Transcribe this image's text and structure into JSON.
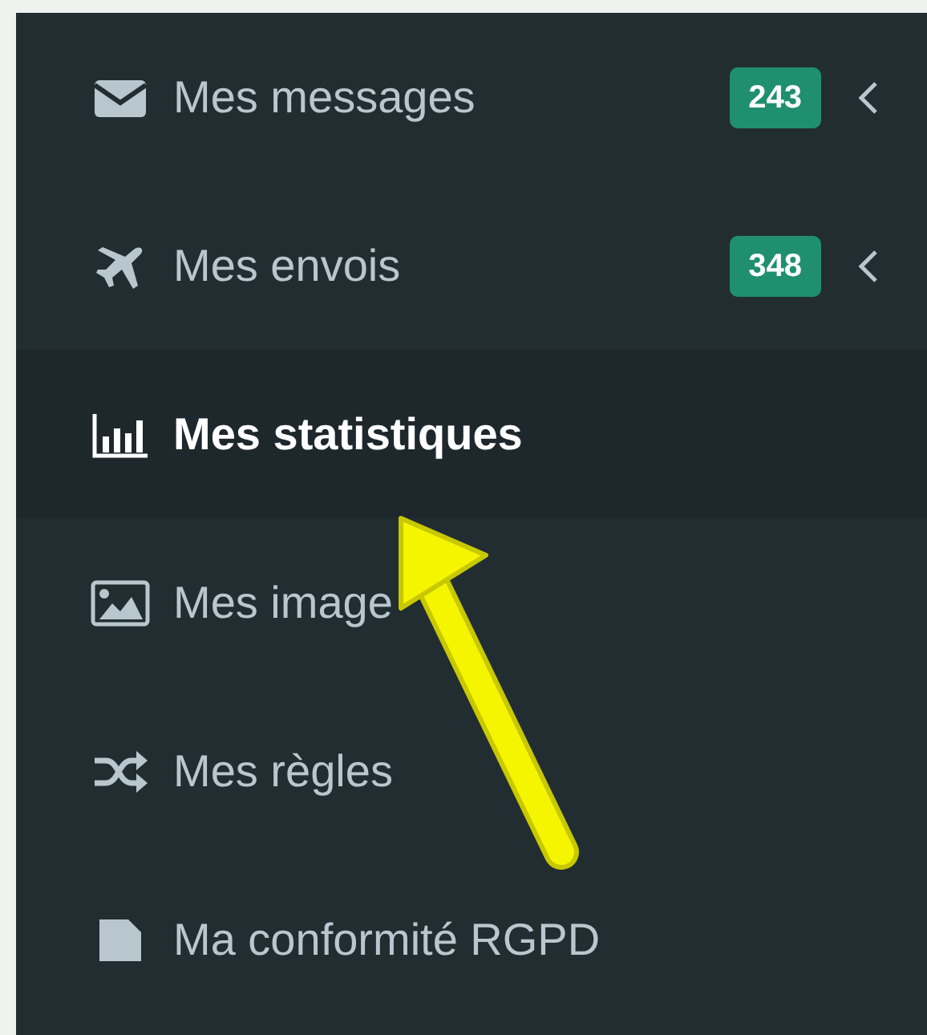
{
  "sidebar": {
    "items": [
      {
        "label": "Mes messages",
        "badge": "243",
        "expandable": true,
        "selected": false
      },
      {
        "label": "Mes envois",
        "badge": "348",
        "expandable": true,
        "selected": false
      },
      {
        "label": "Mes statistiques",
        "expandable": false,
        "selected": true
      },
      {
        "label": "Mes image",
        "expandable": false,
        "selected": false
      },
      {
        "label": "Mes règles",
        "expandable": false,
        "selected": false
      },
      {
        "label": "Ma conformité RGPD",
        "expandable": false,
        "selected": false
      }
    ]
  },
  "annotation": {
    "kind": "arrow"
  }
}
